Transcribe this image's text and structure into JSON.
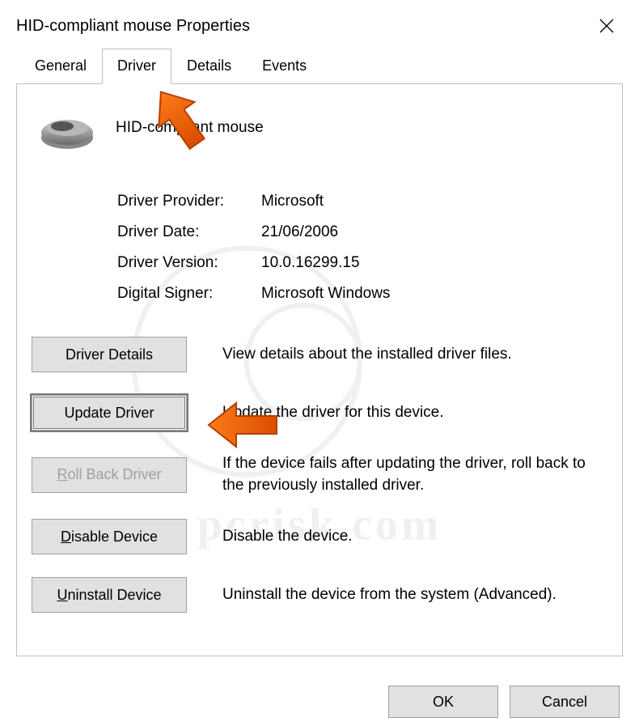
{
  "window": {
    "title": "HID-compliant mouse Properties"
  },
  "tabs": [
    "General",
    "Driver",
    "Details",
    "Events"
  ],
  "active_tab": "Driver",
  "device_name": "HID-compliant mouse",
  "info": {
    "provider_label": "Driver Provider:",
    "provider_value": "Microsoft",
    "date_label": "Driver Date:",
    "date_value": "21/06/2006",
    "version_label": "Driver Version:",
    "version_value": "10.0.16299.15",
    "signer_label": "Digital Signer:",
    "signer_value": "Microsoft Windows"
  },
  "actions": {
    "details_label": "Driver Details",
    "details_desc": "View details about the installed driver files.",
    "update_label": "Update Driver",
    "update_desc": "Update the driver for this device.",
    "rollback_label": "oll Back Driver",
    "rollback_prefix": "R",
    "rollback_desc": "If the device fails after updating the driver, roll back to the previously installed driver.",
    "disable_label": "isable Device",
    "disable_prefix": "D",
    "disable_desc": "Disable the device.",
    "uninstall_label": "ninstall Device",
    "uninstall_prefix": "U",
    "uninstall_desc": "Uninstall the device from the system (Advanced)."
  },
  "footer": {
    "ok": "OK",
    "cancel": "Cancel"
  },
  "watermark_text": "pcrisk.com",
  "annotations": {
    "arrow1_target": "driver-tab",
    "arrow2_target": "update-driver-button"
  }
}
